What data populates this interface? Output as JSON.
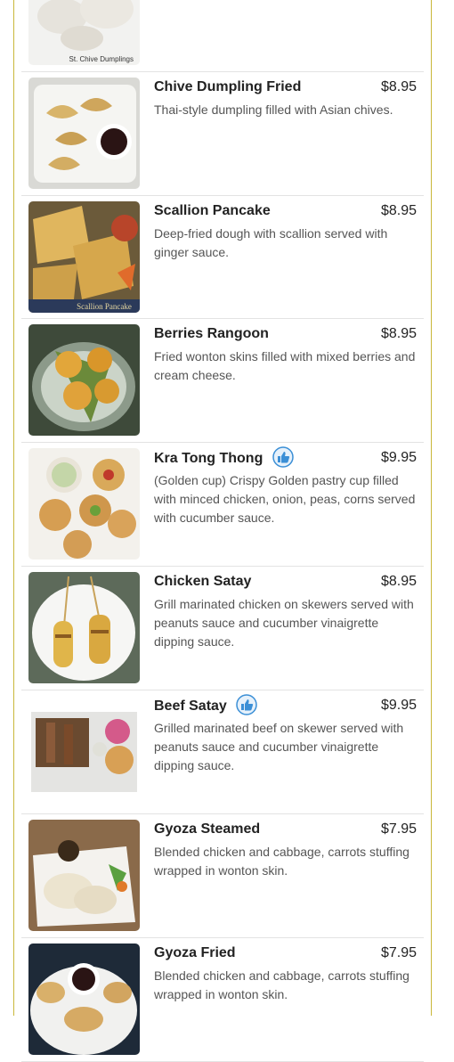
{
  "menu": {
    "items": [
      {
        "name": "",
        "price": "",
        "description": "",
        "image_caption": "St. Chive Dumplings",
        "recommended": false
      },
      {
        "name": "Chive Dumpling Fried",
        "price": "$8.95",
        "description": "Thai-style dumpling filled with Asian chives.",
        "image_caption": "",
        "recommended": false
      },
      {
        "name": "Scallion Pancake",
        "price": "$8.95",
        "description": "Deep-fried dough with scallion served with ginger sauce.",
        "image_caption": "Scallion Pancake",
        "recommended": false
      },
      {
        "name": "Berries Rangoon",
        "price": "$8.95",
        "description": "Fried wonton skins filled with mixed berries and cream cheese.",
        "image_caption": "",
        "recommended": false
      },
      {
        "name": "Kra Tong Thong",
        "price": "$9.95",
        "description": "(Golden cup) Crispy Golden pastry cup filled with minced chicken, onion, peas, corns served with cucumber sauce.",
        "image_caption": "",
        "recommended": true
      },
      {
        "name": "Chicken Satay",
        "price": "$8.95",
        "description": "Grill marinated chicken on skewers served with peanuts sauce and cucumber vinaigrette dipping sauce.",
        "image_caption": "",
        "recommended": false
      },
      {
        "name": "Beef Satay",
        "price": "$9.95",
        "description": "Grilled marinated beef on skewer served with peanuts sauce and cucumber vinaigrette dipping sauce.",
        "image_caption": "",
        "recommended": true
      },
      {
        "name": "Gyoza Steamed",
        "price": "$7.95",
        "description": "Blended chicken and cabbage, carrots stuffing wrapped in wonton skin.",
        "image_caption": "",
        "recommended": false
      },
      {
        "name": "Gyoza Fried",
        "price": "$7.95",
        "description": "Blended chicken and cabbage, carrots stuffing wrapped in wonton skin.",
        "image_caption": "",
        "recommended": false
      }
    ]
  },
  "colors": {
    "frame_border": "#c9b83a",
    "divider": "#e3e3e3",
    "recommended_icon": "#3b8fd6"
  },
  "icons": {
    "recommended": "thumbs-up-icon"
  }
}
